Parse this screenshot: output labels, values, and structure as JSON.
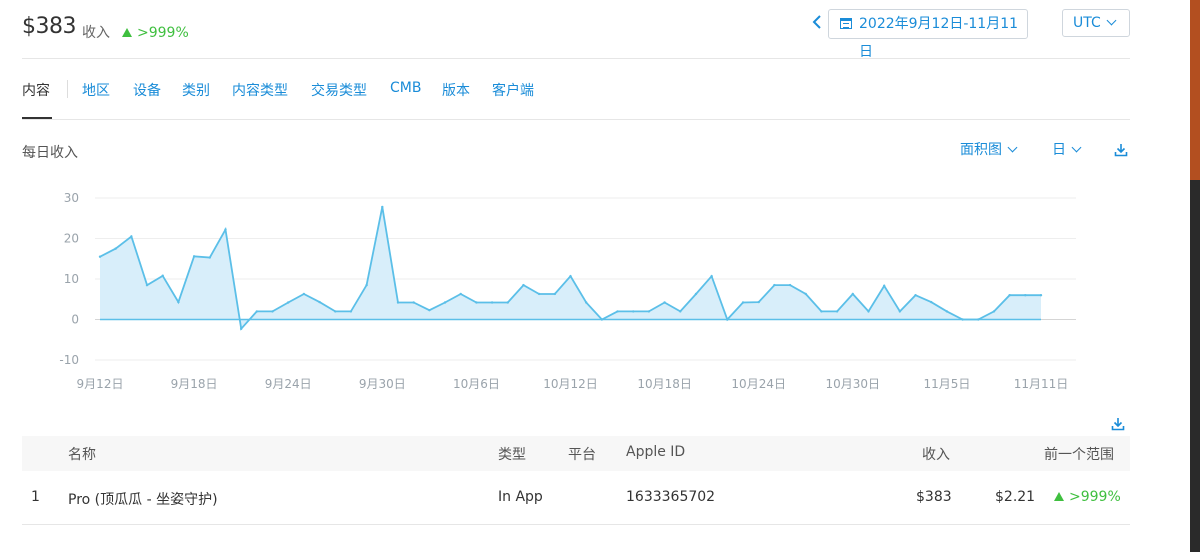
{
  "summary": {
    "total": "$383",
    "label": "收入",
    "change": ">999%",
    "change_color": "#3fbf3f"
  },
  "date_range": {
    "prev_icon": "chevron-left-icon",
    "calendar_icon": "calendar-icon",
    "label": "2022年9月12日-11月11日"
  },
  "timezone": {
    "label": "UTC",
    "icon": "chevron-down-icon"
  },
  "tabs": [
    {
      "label": "内容",
      "active": true
    },
    {
      "label": "地区"
    },
    {
      "label": "设备"
    },
    {
      "label": "类别"
    },
    {
      "label": "内容类型"
    },
    {
      "label": "交易类型"
    },
    {
      "label": "CMB"
    },
    {
      "label": "版本"
    },
    {
      "label": "客户端"
    }
  ],
  "section": {
    "title": "每日收入",
    "chart_type_label": "面积图",
    "granularity_label": "日",
    "download_icon": "download-icon"
  },
  "chart_data": {
    "type": "area",
    "title": "",
    "xlabel": "",
    "ylabel": "",
    "ylim": [
      -10,
      30
    ],
    "yticks": [
      30,
      20,
      10,
      0,
      -10
    ],
    "grid": true,
    "accent": "#5bbfe8",
    "fill": "#d4ecf9",
    "x_tick_labels": [
      "9月12日",
      "9月18日",
      "9月24日",
      "9月30日",
      "10月6日",
      "10月12日",
      "10月18日",
      "10月24日",
      "10月30日",
      "11月5日",
      "11月11日"
    ],
    "x": [
      "9/12",
      "9/13",
      "9/14",
      "9/15",
      "9/16",
      "9/17",
      "9/18",
      "9/19",
      "9/20",
      "9/21",
      "9/22",
      "9/23",
      "9/24",
      "9/25",
      "9/26",
      "9/27",
      "9/28",
      "9/29",
      "9/30",
      "10/1",
      "10/2",
      "10/3",
      "10/4",
      "10/5",
      "10/6",
      "10/7",
      "10/8",
      "10/9",
      "10/10",
      "10/11",
      "10/12",
      "10/13",
      "10/14",
      "10/15",
      "10/16",
      "10/17",
      "10/18",
      "10/19",
      "10/20",
      "10/21",
      "10/22",
      "10/23",
      "10/24",
      "10/25",
      "10/26",
      "10/27",
      "10/28",
      "10/29",
      "10/30",
      "10/31",
      "11/1",
      "11/2",
      "11/3",
      "11/4",
      "11/5",
      "11/6",
      "11/7",
      "11/8",
      "11/9",
      "11/10",
      "11/11"
    ],
    "series": [
      {
        "values": [
          15.5,
          17.5,
          20.5,
          8.5,
          10.8,
          4.3,
          15.6,
          15.3,
          22.2,
          -2.3,
          2.0,
          2.0,
          4.2,
          6.3,
          4.3,
          2.0,
          2.0,
          8.5,
          27.8,
          4.2,
          4.2,
          2.3,
          4.2,
          6.3,
          4.2,
          4.2,
          4.2,
          8.5,
          6.3,
          6.3,
          10.7,
          4.2,
          0.0,
          2.0,
          2.0,
          2.0,
          4.2,
          2.0,
          6.3,
          10.7,
          0.0,
          4.2,
          4.3,
          8.5,
          8.5,
          6.3,
          2.0,
          2.0,
          6.3,
          2.0,
          8.3,
          2.0,
          6.0,
          4.3,
          2.0,
          0.0,
          0.0,
          2.0,
          6.0,
          6.0,
          6.0
        ]
      }
    ]
  },
  "table_download_icon": "download-icon",
  "table": {
    "headers": {
      "name": "名称",
      "type": "类型",
      "platform": "平台",
      "apple_id": "Apple ID",
      "revenue": "收入",
      "prev_range": "前一个范围"
    },
    "rows": [
      {
        "index": "1",
        "name": "Pro (顶瓜瓜 - 坐姿守护)",
        "type": "In App",
        "platform": "",
        "apple_id": "1633365702",
        "revenue": "$383",
        "prev_value": "$2.21",
        "change": ">999%"
      }
    ]
  }
}
